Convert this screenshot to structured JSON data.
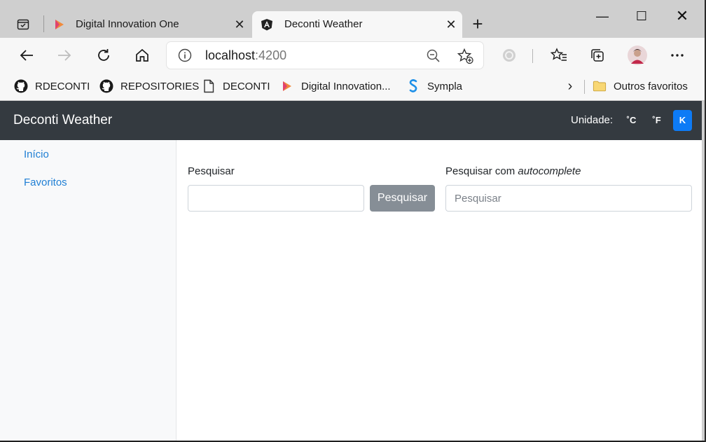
{
  "browser": {
    "tabs": [
      {
        "title": "Digital Innovation One",
        "active": false
      },
      {
        "title": "Deconti Weather",
        "active": true
      }
    ],
    "close_glyph": "✕",
    "new_tab_glyph": "+",
    "window_controls": {
      "minimize": "—",
      "maximize": "☐",
      "close": "✕"
    },
    "address": {
      "host": "localhost",
      "port": ":4200"
    },
    "bookmarks": [
      {
        "label": "RDECONTI",
        "icon": "github-icon"
      },
      {
        "label": "REPOSITORIES",
        "icon": "github-icon"
      },
      {
        "label": "DECONTI",
        "icon": "page-icon"
      },
      {
        "label": "Digital Innovation...",
        "icon": "dio-icon"
      },
      {
        "label": "Sympla",
        "icon": "sympla-icon"
      }
    ],
    "bookmarks_overflow": "›",
    "other_favorites": "Outros favoritos"
  },
  "app": {
    "brand": "Deconti Weather",
    "unit_label": "Unidade:",
    "units": {
      "celsius": "˚C",
      "fahrenheit": "˚F",
      "kelvin": "K"
    },
    "selected_unit": "kelvin",
    "sidebar": [
      {
        "label": "Início"
      },
      {
        "label": "Favoritos"
      }
    ],
    "search": {
      "label": "Pesquisar",
      "value": "",
      "button_label": "Pesquisar"
    },
    "autocomplete": {
      "label_prefix": "Pesquisar com ",
      "label_em": "autocomplete",
      "placeholder": "Pesquisar"
    }
  },
  "colors": {
    "navbar": "#343a40",
    "accent": "#0d7bf6",
    "link": "#1f7fd4",
    "button_gray": "#868e96"
  }
}
